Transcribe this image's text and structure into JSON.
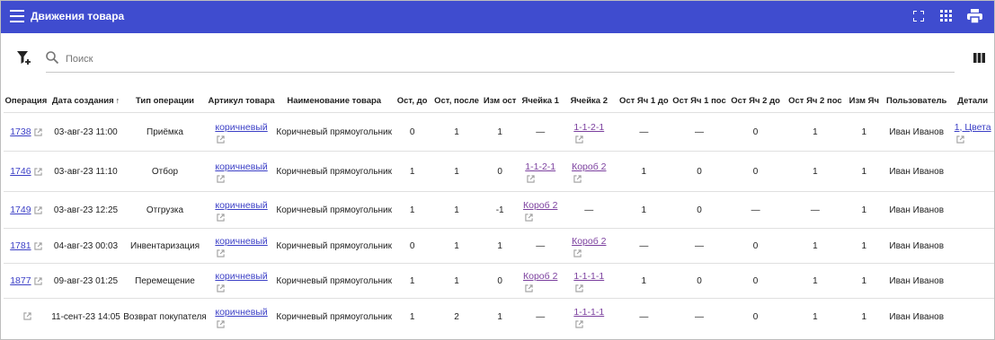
{
  "appbar": {
    "title": "Движения товара"
  },
  "search": {
    "placeholder": "Поиск",
    "value": ""
  },
  "table": {
    "headers": [
      "Операция",
      "Дата создания",
      "Тип операции",
      "Артикул товара",
      "Наименование товара",
      "Ост, до",
      "Ост, после",
      "Изм ост",
      "Ячейка 1",
      "Ячейка 2",
      "Ост Яч 1 до",
      "Ост Яч 1 пос",
      "Ост Яч 2 до",
      "Ост Яч 2 пос",
      "Изм Яч",
      "Пользователь",
      "Детали"
    ],
    "sort_indicator": "↑",
    "rows": [
      {
        "op": "1738",
        "date": "03-авг-23 11:00",
        "type": "Приёмка",
        "sku": "коричневый",
        "name": "Коричневый прямоугольник",
        "before": "0",
        "after": "1",
        "diff": "1",
        "cell1": "—",
        "cell2": "1-1-2-1",
        "c1b": "—",
        "c1a": "—",
        "c2b": "0",
        "c2a": "1",
        "cdiff": "1",
        "user": "Иван Иванов",
        "details": "1, Цвета"
      },
      {
        "op": "1746",
        "date": "03-авг-23 11:10",
        "type": "Отбор",
        "sku": "коричневый",
        "name": "Коричневый прямоугольник",
        "before": "1",
        "after": "1",
        "diff": "0",
        "cell1": "1-1-2-1",
        "cell2": "Короб 2",
        "c1b": "1",
        "c1a": "0",
        "c2b": "0",
        "c2a": "1",
        "cdiff": "1",
        "user": "Иван Иванов",
        "details": ""
      },
      {
        "op": "1749",
        "date": "03-авг-23 12:25",
        "type": "Отгрузка",
        "sku": "коричневый",
        "name": "Коричневый прямоугольник",
        "before": "1",
        "after": "1",
        "diff": "-1",
        "cell1": "Короб 2",
        "cell2": "—",
        "c1b": "1",
        "c1a": "0",
        "c2b": "—",
        "c2a": "—",
        "cdiff": "1",
        "user": "Иван Иванов",
        "details": ""
      },
      {
        "op": "1781",
        "date": "04-авг-23 00:03",
        "type": "Инвентаризация",
        "sku": "коричневый",
        "name": "Коричневый прямоугольник",
        "before": "0",
        "after": "1",
        "diff": "1",
        "cell1": "—",
        "cell2": "Короб 2",
        "c1b": "—",
        "c1a": "—",
        "c2b": "0",
        "c2a": "1",
        "cdiff": "1",
        "user": "Иван Иванов",
        "details": ""
      },
      {
        "op": "1877",
        "date": "09-авг-23 01:25",
        "type": "Перемещение",
        "sku": "коричневый",
        "name": "Коричневый прямоугольник",
        "before": "1",
        "after": "1",
        "diff": "0",
        "cell1": "Короб 2",
        "cell2": "1-1-1-1",
        "c1b": "1",
        "c1a": "0",
        "c2b": "0",
        "c2a": "1",
        "cdiff": "1",
        "user": "Иван Иванов",
        "details": ""
      },
      {
        "op": "",
        "date": "11-сент-23 14:05",
        "type": "Возврат покупателя",
        "sku": "коричневый",
        "name": "Коричневый прямоугольник",
        "before": "1",
        "after": "2",
        "diff": "1",
        "cell1": "—",
        "cell2": "1-1-1-1",
        "c1b": "—",
        "c1a": "—",
        "c2b": "0",
        "c2a": "1",
        "cdiff": "1",
        "user": "Иван Иванов",
        "details": ""
      }
    ]
  },
  "colors": {
    "appbar": "#3f4ccf",
    "link": "#3b3fc6",
    "visited_link": "#7b3f9e"
  },
  "icons": [
    "menu-icon",
    "fullscreen-icon",
    "apps-grid-icon",
    "print-icon",
    "filter-add-icon",
    "search-icon",
    "columns-icon",
    "open-external-icon"
  ]
}
